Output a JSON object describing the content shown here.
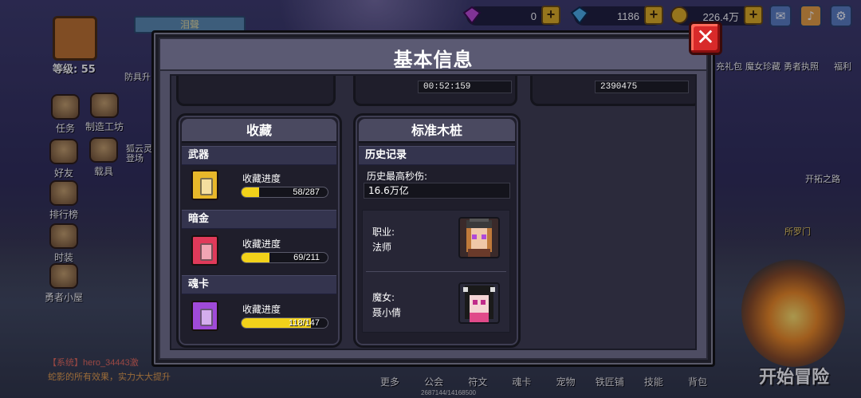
{
  "top_bar": {
    "gem_count": "0",
    "diamond_count": "1186",
    "gold_count": "226.4万",
    "plus": "+"
  },
  "player": {
    "level": "等级: 55",
    "name": "泪聲"
  },
  "left_menu": [
    {
      "label": "任务"
    },
    {
      "label": "制造工坊"
    },
    {
      "label": "好友"
    },
    {
      "label": "载具"
    },
    {
      "label": "排行榜"
    },
    {
      "label": "时装"
    },
    {
      "label": "勇者小屋"
    }
  ],
  "left_misc": {
    "armor_label": "防具升",
    "fox_label": "狐云灵",
    "stage_label": "登场"
  },
  "right_menu": {
    "tabs": [
      "充礼包",
      "魔女珍藏",
      "勇者执照",
      "福利"
    ],
    "pioneer": "开拓之路",
    "gate": "所罗门",
    "start": "开始冒险"
  },
  "chat": {
    "line1": "【系统】hero_34443激",
    "line2": "蛇影的所有效果，实力大大提升"
  },
  "bottom_tabs": [
    "更多",
    "公会",
    "符文",
    "魂卡",
    "宠物",
    "铁匠铺",
    "技能",
    "背包"
  ],
  "hp_text": "2687144/14168500",
  "modal": {
    "title": "基本信息",
    "close": "✕",
    "top_fields": [
      "00:52:159",
      "2390475"
    ],
    "collection": {
      "title": "收藏",
      "categories": [
        {
          "name": "武器",
          "progress_label": "收藏进度",
          "progress_text": "58/287",
          "fraction": 0.202,
          "color": "#e8b82a"
        },
        {
          "name": "暗金",
          "progress_label": "收藏进度",
          "progress_text": "69/211",
          "fraction": 0.327,
          "color": "#e03a5a"
        },
        {
          "name": "魂卡",
          "progress_label": "收藏进度",
          "progress_text": "118/147",
          "fraction": 0.803,
          "color": "#a04ad8"
        }
      ]
    },
    "dummy": {
      "title": "标准木桩",
      "history_header": "历史记录",
      "max_dps_label": "历史最高秒伤:",
      "max_dps_value": "16.6万亿",
      "class_key": "职业:",
      "class_value": "法师",
      "witch_key": "魔女:",
      "witch_value": "聂小倩"
    }
  }
}
